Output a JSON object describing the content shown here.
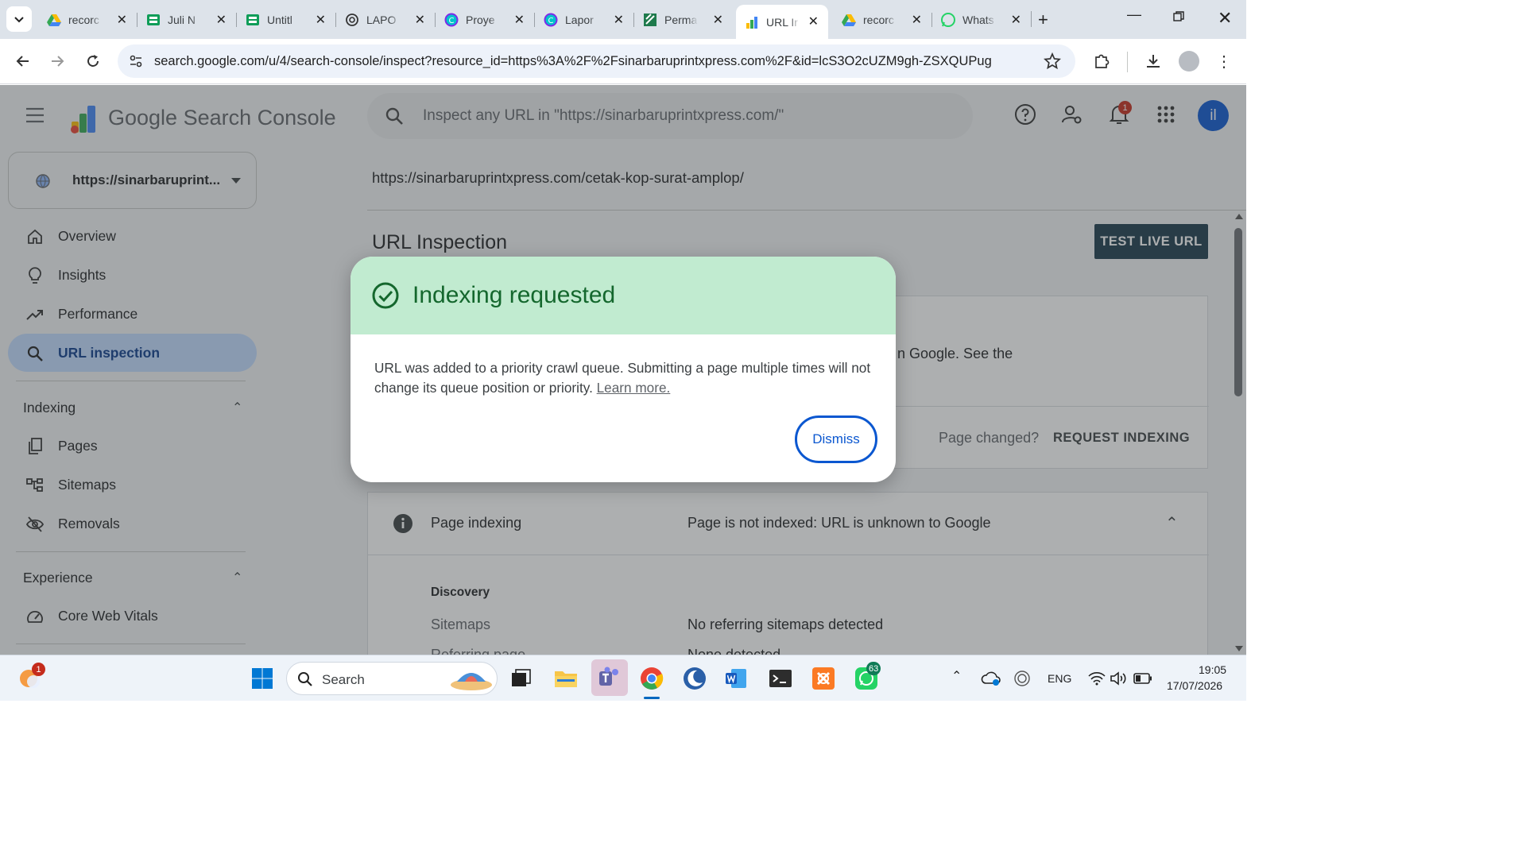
{
  "browser": {
    "tabs": [
      {
        "title": "recorc",
        "icon": "google-drive-icon"
      },
      {
        "title": "Juli N",
        "icon": "google-sheets-icon"
      },
      {
        "title": "Untitl",
        "icon": "google-sheets-icon"
      },
      {
        "title": "LAPO",
        "icon": "openai-icon"
      },
      {
        "title": "Proye",
        "icon": "canva-icon"
      },
      {
        "title": "Lapor",
        "icon": "canva-icon"
      },
      {
        "title": "Perma",
        "icon": "permata-icon"
      },
      {
        "title": "URL Ir",
        "icon": "search-console-icon",
        "active": true
      },
      {
        "title": "recorc",
        "icon": "google-drive-icon"
      },
      {
        "title": "Whats",
        "icon": "whatsapp-icon"
      }
    ],
    "url": "search.google.com/u/4/search-console/inspect?resource_id=https%3A%2F%2Fsinarbaruprintxpress.com%2F&id=lcS3O2cUZM9gh-ZSXQUPug"
  },
  "app": {
    "brand": "Google Search Console",
    "search_placeholder": "Inspect any URL in \"https://sinarbaruprintxpress.com/\"",
    "notification_count": "1",
    "avatar_initials": "il",
    "property": "https://sinarbaruprint...",
    "nav": {
      "overview": "Overview",
      "insights": "Insights",
      "performance": "Performance",
      "url_inspection": "URL inspection",
      "indexing_header": "Indexing",
      "pages": "Pages",
      "sitemaps": "Sitemaps",
      "removals": "Removals",
      "experience_header": "Experience",
      "core_web_vitals": "Core Web Vitals"
    },
    "inspected_url": "https://sinarbaruprintxpress.com/cetak-kop-surat-amplop/",
    "page_title": "URL Inspection",
    "test_live_url": "TEST LIVE URL",
    "status_fragment": "n Google. See the",
    "page_changed": "Page changed?",
    "request_indexing": "REQUEST INDEXING",
    "page_indexing_label": "Page indexing",
    "page_indexing_status": "Page is not indexed: URL is unknown to Google",
    "discovery_label": "Discovery",
    "sitemaps_label": "Sitemaps",
    "sitemaps_value": "No referring sitemaps detected",
    "referring_label": "Referring page",
    "referring_value": "None detected"
  },
  "dialog": {
    "title": "Indexing requested",
    "body": "URL was added to a priority crawl queue. Submitting a page multiple times will not change its queue position or priority.",
    "link": "Learn more.",
    "dismiss": "Dismiss"
  },
  "taskbar": {
    "search": "Search",
    "weather_badge": "1",
    "whatsapp_badge": "63",
    "language": "ENG",
    "time": "19:05",
    "date": "17/07/2026"
  }
}
